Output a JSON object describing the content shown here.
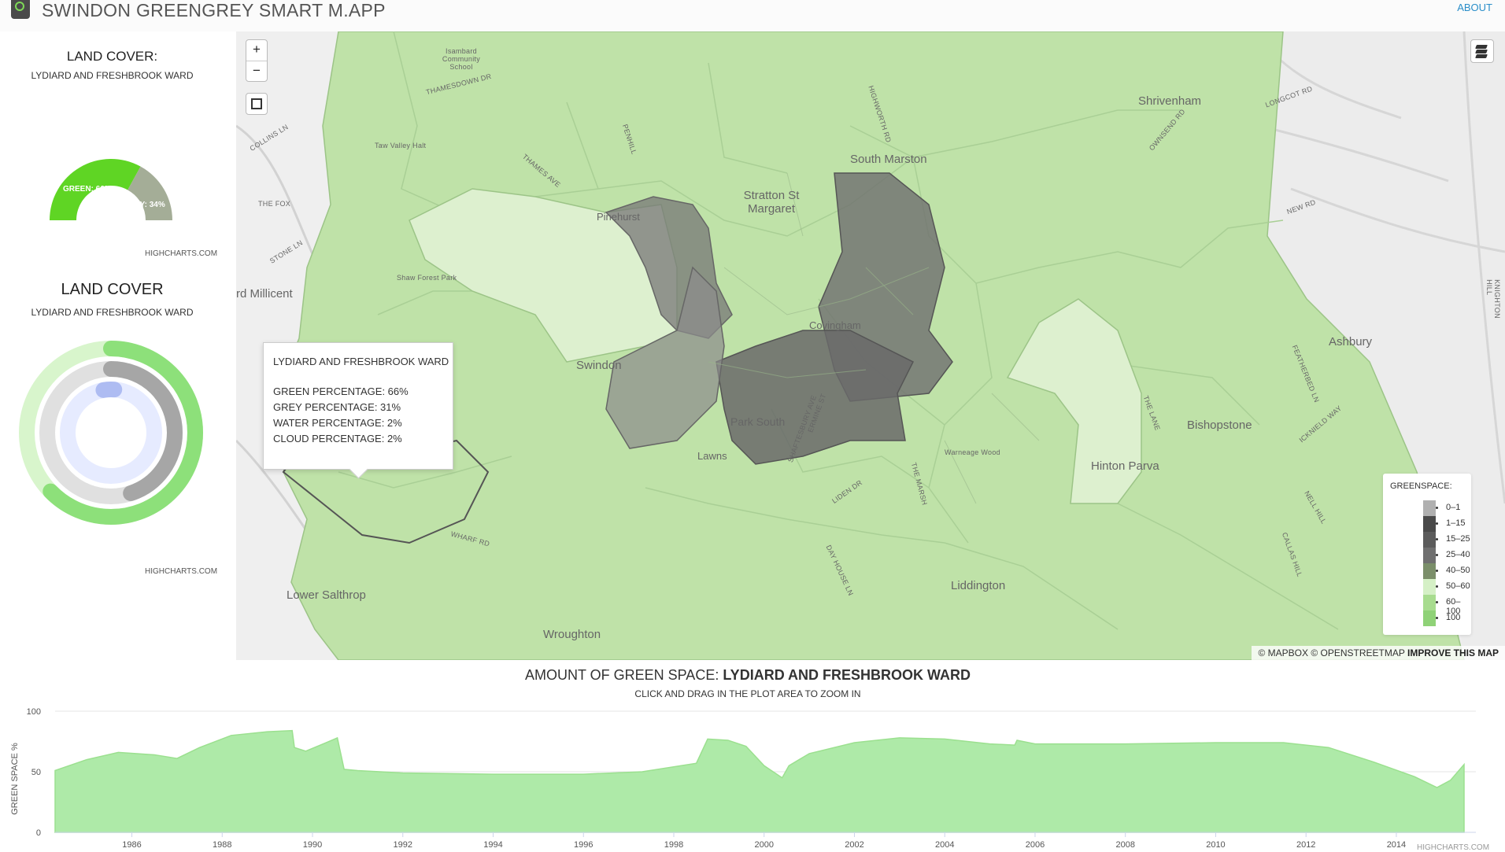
{
  "app": {
    "title": "SWINDON GREENGREY SMART M.APP",
    "about": "ABOUT"
  },
  "gauge": {
    "title": "LAND COVER:",
    "subtitle": "LYDIARD AND FRESHBROOK WARD",
    "green_label": "GREEN: 66%",
    "grey_label": "GREY: 34%",
    "green_value": 66,
    "grey_value": 34,
    "credit": "HIGHCHARTS.COM",
    "colors": {
      "green": "#5fd524",
      "grey": "#a4ad97"
    }
  },
  "rings": {
    "title": "LAND COVER",
    "subtitle": "LYDIARD AND FRESHBROOK WARD",
    "green": 66,
    "grey": 31,
    "water": 2,
    "cloud": 2,
    "credit": "HIGHCHARTS.COM"
  },
  "map": {
    "zoom_in": "+",
    "zoom_out": "−",
    "places": [
      "Shrivenham",
      "South Marston",
      "Stratton St Margaret",
      "Pinehurst",
      "Covingham",
      "Swindon",
      "Park South",
      "Lawns",
      "Bishopstone",
      "Hinton Parva",
      "Ashbury",
      "Liddington",
      "Lower Salthrop",
      "Wroughton",
      "rd Millicent"
    ],
    "road_labels": [
      "Isambard Community School",
      "THAMESDOWN DR",
      "Taw Valley Halt",
      "COLLINS LN",
      "THE FOX",
      "STONE LN",
      "Shaw Forest Park",
      "THAMES AVE",
      "PENHILL",
      "HIGHWORTH RD",
      "LONGCOT RD",
      "OWNSEND RD",
      "NEW RD",
      "ICKNIELD WAY",
      "FEATHERBED LN",
      "THE LANE",
      "NELL HILL",
      "CALLAS HILL",
      "Warneage Wood",
      "THE MARSH",
      "LIDEN DR",
      "DAY HOUSE LN",
      "WHARF RD",
      "KNIGHTON HILL",
      "SHAFTESBURY AVE",
      "ERMINE ST"
    ],
    "tooltip": {
      "title": "LYDIARD AND FRESHBROOK WARD",
      "lines": [
        "GREEN PERCENTAGE: 66%",
        "GREY PERCENTAGE: 31%",
        "WATER PERCENTAGE: 2%",
        "CLOUD PERCENTAGE: 2%"
      ]
    },
    "legend": {
      "title": "GREENSPACE:",
      "items": [
        {
          "label": "0–1",
          "color": "#b0b0b0"
        },
        {
          "label": "1–15",
          "color": "#4a4a4a"
        },
        {
          "label": "15–25",
          "color": "#5c5c5c"
        },
        {
          "label": "25–40",
          "color": "#707070"
        },
        {
          "label": "40–50",
          "color": "#7b8f6a"
        },
        {
          "label": "50–60",
          "color": "#d5f0c6"
        },
        {
          "label": "60–100",
          "color": "#a8dc8f"
        },
        {
          "label": "100",
          "color": "#8fd277"
        }
      ]
    },
    "attribution": {
      "text": "© MAPBOX © OPENSTREETMAP",
      "link": "IMPROVE THIS MAP"
    }
  },
  "timeline": {
    "title_prefix": "AMOUNT OF GREEN SPACE:",
    "title_ward": "LYDIARD AND FRESHBROOK WARD",
    "subtitle": "CLICK AND DRAG IN THE PLOT AREA TO ZOOM IN",
    "credit": "HIGHCHARTS.COM"
  },
  "chart_data": {
    "type": "area",
    "title": "AMOUNT OF GREEN SPACE: LYDIARD AND FRESHBROOK WARD",
    "ylabel": "GREEN SPACE %",
    "xlabel": "",
    "ylim": [
      0,
      100
    ],
    "xlim": [
      1984.3,
      2015.5
    ],
    "yticks": [
      0,
      50,
      100
    ],
    "xticks": [
      1986,
      1988,
      1990,
      1992,
      1994,
      1996,
      1998,
      2000,
      2002,
      2004,
      2006,
      2008,
      2010,
      2012,
      2014
    ],
    "color": "#aeeaa8",
    "series": [
      {
        "x": [
          1984.3,
          1985.0,
          1985.7,
          1986.5,
          1987.0,
          1987.5,
          1988.2,
          1989.0,
          1989.55,
          1989.6,
          1989.85,
          1990.3,
          1990.55,
          1990.7,
          1991.0,
          1992.0,
          1994.0,
          1996.0,
          1997.3,
          1998.5,
          1998.75,
          1999.2,
          1999.6,
          2000.0,
          2000.4,
          2000.55,
          2001.0,
          2002.0,
          2003.0,
          2004.0,
          2005.0,
          2005.55,
          2005.6,
          2006.0,
          2008.0,
          2010.0,
          2011.5,
          2012.5,
          2013.5,
          2014.4,
          2014.9,
          2015.2,
          2015.5
        ],
        "y": [
          51,
          60,
          66,
          64,
          61,
          70,
          80,
          83,
          84,
          70,
          67,
          74,
          78,
          52,
          51,
          49,
          48,
          48,
          50,
          57,
          77,
          76,
          71,
          55,
          45,
          55,
          65,
          74,
          78,
          77,
          73,
          72,
          76,
          73,
          73,
          74,
          74,
          70,
          58,
          46,
          37,
          43,
          56
        ]
      }
    ]
  }
}
